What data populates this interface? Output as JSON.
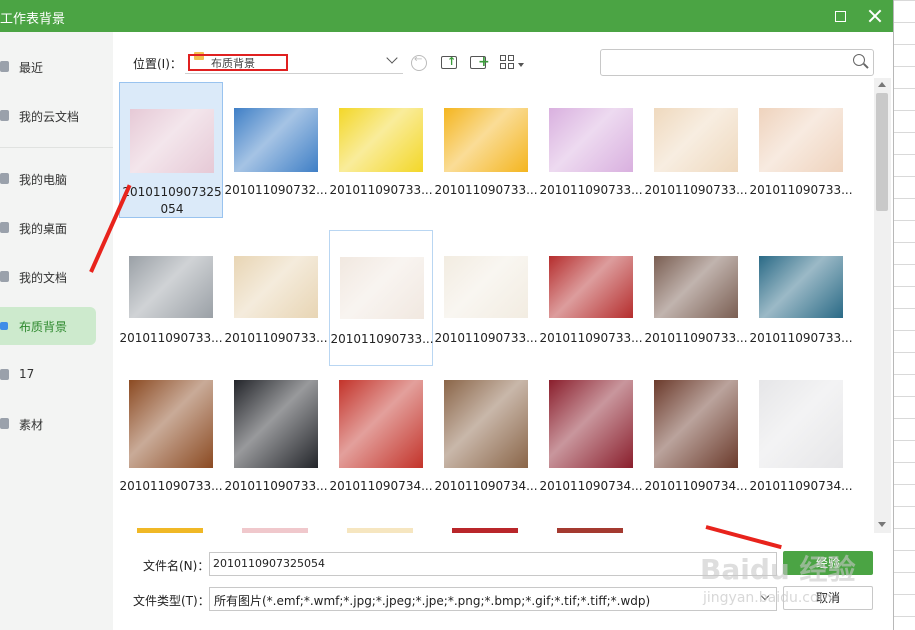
{
  "window": {
    "title": "工作表背景"
  },
  "sidebar": {
    "items": [
      {
        "label": "最近"
      },
      {
        "label": "我的云文档"
      },
      {
        "label": "我的电脑"
      },
      {
        "label": "我的桌面"
      },
      {
        "label": "我的文档"
      },
      {
        "label": "布质背景",
        "active": true
      },
      {
        "label": "17"
      },
      {
        "label": "素材"
      }
    ]
  },
  "toolbar": {
    "location_label": "位置(I)：",
    "location_value": "布质背景"
  },
  "search": {
    "placeholder": ""
  },
  "files": [
    {
      "name": "20101109073250 54",
      "swatch": "#e6c9d6"
    },
    {
      "name": "2010110907 32...",
      "swatch": "#3f7fc6"
    },
    {
      "name": "2010110907 33...",
      "swatch": "#f3d728"
    },
    {
      "name": "2010110907 33...",
      "swatch": "#f4b51f"
    },
    {
      "name": "2010110907 33...",
      "swatch": "#d9b0df"
    },
    {
      "name": "2010110907 33...",
      "swatch": "#efd9be"
    },
    {
      "name": "2010110907 33...",
      "swatch": "#efd3bd"
    },
    {
      "name": "2010110907 33...",
      "swatch": "#9aa0a6"
    },
    {
      "name": "2010110907 33...",
      "swatch": "#e8d5b4"
    },
    {
      "name": "2010110907 33...",
      "swatch": "#f1e8e0"
    },
    {
      "name": "2010110907 33...",
      "swatch": "#f2ece1"
    },
    {
      "name": "2010110907 33...",
      "swatch": "#b52d2d"
    },
    {
      "name": "2010110907 33...",
      "swatch": "#7a5e52"
    },
    {
      "name": "2010110907 33...",
      "swatch": "#2a6a86"
    },
    {
      "name": "2010110907 33...",
      "swatch": "#8b4a22"
    },
    {
      "name": "2010110907 33...",
      "swatch": "#23252a"
    },
    {
      "name": "2010110907 34...",
      "swatch": "#c3332a"
    },
    {
      "name": "2010110907 34...",
      "swatch": "#8a6548"
    },
    {
      "name": "2010110907 34...",
      "swatch": "#8a1e2c"
    },
    {
      "name": "2010110907 34...",
      "swatch": "#6b3a2b"
    },
    {
      "name": "2010110907 34...",
      "swatch": "#e6e6e8"
    }
  ],
  "files_partial_row": [
    "#f0b826",
    "#f0c8cc",
    "#f6e6c0",
    "#b9262a",
    "#a43a30"
  ],
  "footer": {
    "filename_label": "文件名(N)：",
    "filename_value": "2010110907325054",
    "filetype_label": "文件类型(T)：",
    "filetype_value": "所有图片(*.emf;*.wmf;*.jpg;*.jpeg;*.jpe;*.png;*.bmp;*.gif;*.tif;*.tiff;*.wdp)",
    "open_label": "经验",
    "cancel_label": "取消"
  },
  "watermark": {
    "text": "Baidu 经验",
    "sub": "jingyan.baidu.com"
  },
  "colors": {
    "accent": "#4ba444",
    "annotation": "#e8231c"
  }
}
